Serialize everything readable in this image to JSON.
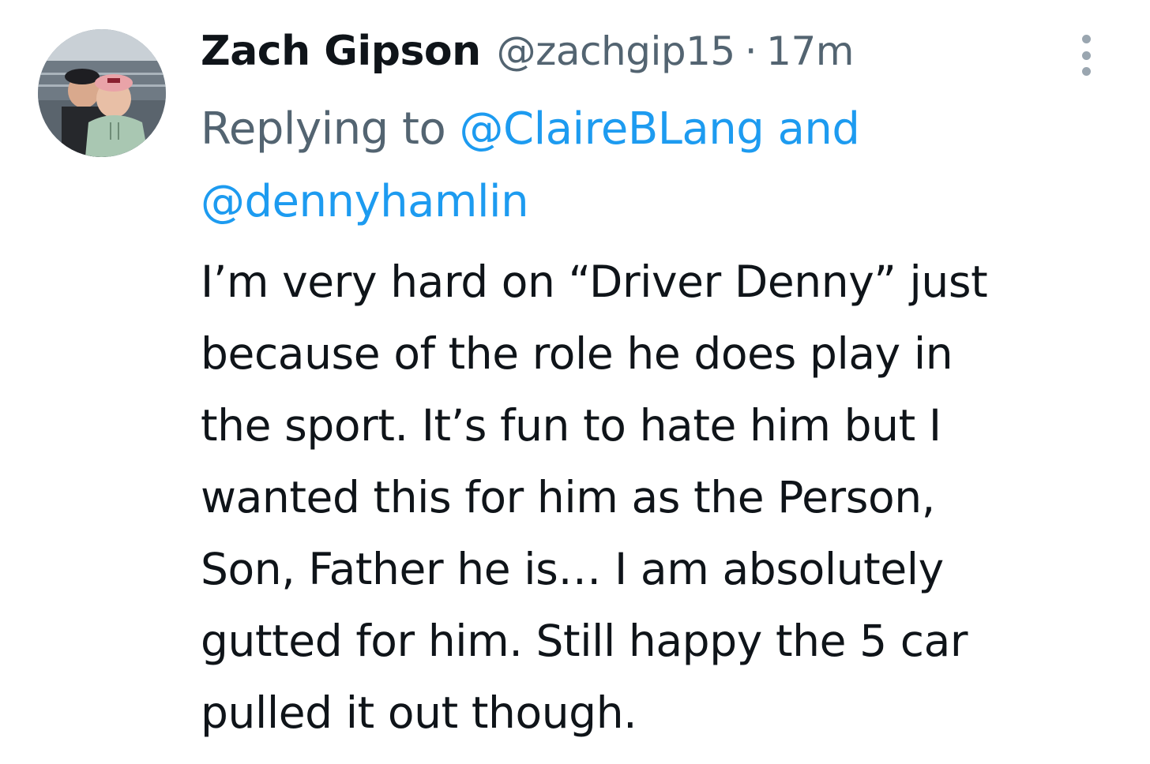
{
  "tweet": {
    "author": {
      "display_name": "Zach Gipson",
      "handle": "@zachgip15",
      "avatar_icon": "profile-photo-two-people-in-stadium"
    },
    "separator": "·",
    "time": "17m",
    "more_icon": "vertical-ellipsis-icon",
    "replying": {
      "prefix": "Replying to",
      "mention_1": "@ClaireBLang",
      "conjunction": "and",
      "mention_2": "@dennyhamlin"
    },
    "body_lines": [
      "I’m very hard on “Driver Denny” just",
      "because of the role he does play in",
      "the sport. It’s fun to hate him but I",
      "wanted this for him as the Person,",
      "Son, Father he is… I am absolutely",
      "gutted for him. Still happy the 5 car",
      "pulled it out though."
    ]
  },
  "colors": {
    "text_primary": "#0f1419",
    "text_secondary": "#536471",
    "link": "#1d9bf0",
    "background": "#ffffff"
  }
}
